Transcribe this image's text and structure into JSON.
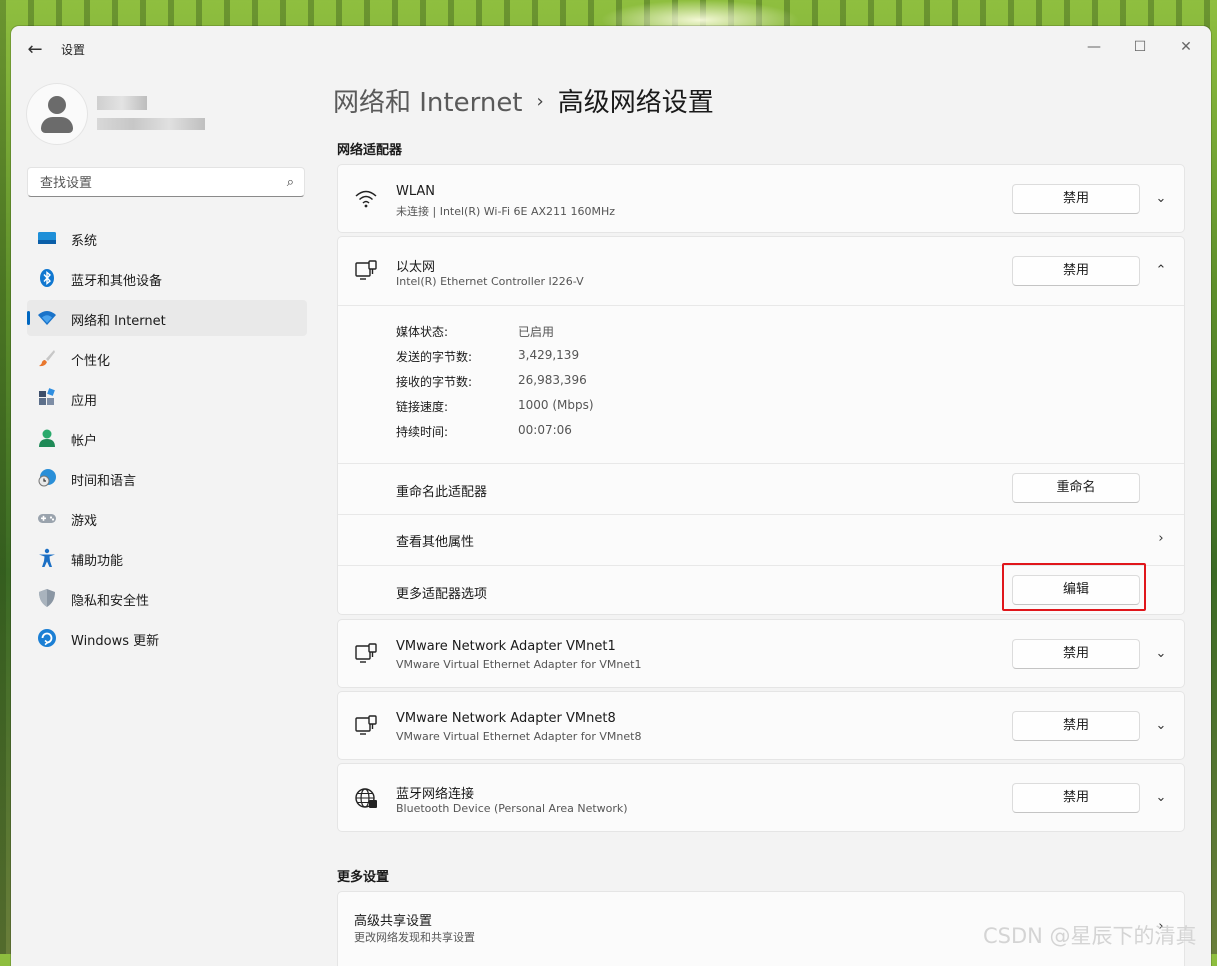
{
  "window": {
    "title": "设置",
    "back_glyph": "←",
    "minimize": "—",
    "maximize": "☐",
    "close": "✕"
  },
  "search": {
    "placeholder": "查找设置"
  },
  "sidebar": {
    "items": [
      {
        "label": "系统",
        "icon": "system-icon"
      },
      {
        "label": "蓝牙和其他设备",
        "icon": "bluetooth-icon"
      },
      {
        "label": "网络和 Internet",
        "icon": "network-icon",
        "active": true
      },
      {
        "label": "个性化",
        "icon": "brush-icon"
      },
      {
        "label": "应用",
        "icon": "apps-icon"
      },
      {
        "label": "帐户",
        "icon": "account-icon"
      },
      {
        "label": "时间和语言",
        "icon": "time-language-icon"
      },
      {
        "label": "游戏",
        "icon": "gamepad-icon"
      },
      {
        "label": "辅助功能",
        "icon": "accessibility-icon"
      },
      {
        "label": "隐私和安全性",
        "icon": "shield-icon"
      },
      {
        "label": "Windows 更新",
        "icon": "update-icon"
      }
    ]
  },
  "breadcrumb": {
    "parent": "网络和 Internet",
    "separator": "›",
    "current": "高级网络设置"
  },
  "adapters_section": {
    "title": "网络适配器"
  },
  "adapters": [
    {
      "name": "WLAN",
      "sub": "未连接 | Intel(R) Wi-Fi 6E AX211 160MHz",
      "button": "禁用",
      "icon": "wifi-icon",
      "expanded": false
    },
    {
      "name": "以太网",
      "sub": "Intel(R) Ethernet Controller I226-V",
      "button": "禁用",
      "icon": "ethernet-icon",
      "expanded": true
    },
    {
      "name": "VMware Network Adapter VMnet1",
      "sub": "VMware Virtual Ethernet Adapter for VMnet1",
      "button": "禁用",
      "icon": "ethernet-icon",
      "expanded": false
    },
    {
      "name": "VMware Network Adapter VMnet8",
      "sub": "VMware Virtual Ethernet Adapter for VMnet8",
      "button": "禁用",
      "icon": "ethernet-icon",
      "expanded": false
    },
    {
      "name": "蓝牙网络连接",
      "sub": "Bluetooth Device (Personal Area Network)",
      "button": "禁用",
      "icon": "globe-icon",
      "expanded": false
    }
  ],
  "ethernet_details": {
    "stats": [
      {
        "label": "媒体状态:",
        "value": "已启用"
      },
      {
        "label": "发送的字节数:",
        "value": "3,429,139"
      },
      {
        "label": "接收的字节数:",
        "value": "26,983,396"
      },
      {
        "label": "链接速度:",
        "value": "1000 (Mbps)"
      },
      {
        "label": "持续时间:",
        "value": "00:07:06"
      }
    ],
    "rename": {
      "label": "重命名此适配器",
      "button": "重命名"
    },
    "properties": {
      "label": "查看其他属性"
    },
    "more_options": {
      "label": "更多适配器选项",
      "button": "编辑"
    }
  },
  "more_settings": {
    "title": "更多设置",
    "items": [
      {
        "label": "高级共享设置",
        "sub": "更改网络发现和共享设置"
      }
    ]
  },
  "glyphs": {
    "chevron_down": "⌄",
    "chevron_up": "⌃",
    "chevron_right": "›",
    "search": "⌕"
  },
  "colors": {
    "accent": "#0067c0",
    "highlight_box": "#e0161b"
  },
  "watermark": "CSDN @星辰下的清真"
}
